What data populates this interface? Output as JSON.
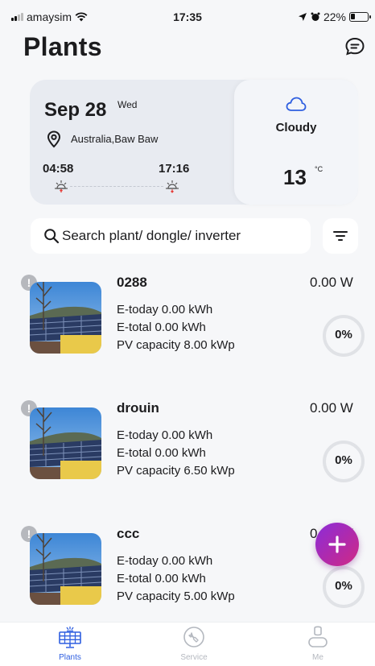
{
  "status_bar": {
    "carrier": "amaysim",
    "time": "17:35",
    "battery": "22%"
  },
  "header": {
    "title": "Plants",
    "chat_icon": "chat-bubble-icon"
  },
  "weather": {
    "date": "Sep 28",
    "weekday": "Wed",
    "location": "Australia,Baw Baw",
    "sunrise": "04:58",
    "sunset": "17:16",
    "condition": "Cloudy",
    "temperature": "13",
    "unit": "°C",
    "condition_icon": "cloud-icon"
  },
  "search": {
    "placeholder": "Search plant/ dongle/ inverter",
    "value": ""
  },
  "plants": [
    {
      "name": "0288",
      "power": "0.00 W",
      "e_today": "E-today 0.00 kWh",
      "e_total": "E-total 0.00 kWh",
      "capacity": "PV capacity 8.00 kWp",
      "percent_label": "0%",
      "percent": 0
    },
    {
      "name": "drouin",
      "power": "0.00 W",
      "e_today": "E-today 0.00 kWh",
      "e_total": "E-total 0.00 kWh",
      "capacity": "PV capacity 6.50 kWp",
      "percent_label": "0%",
      "percent": 0
    },
    {
      "name": "ccc",
      "power": "0.00 W",
      "e_today": "E-today 0.00 kWh",
      "e_total": "E-total 0.00 kWh",
      "capacity": "PV capacity 5.00 kWp",
      "percent_label": "0%",
      "percent": 0
    }
  ],
  "alert_glyph": "!",
  "bottom_nav": [
    {
      "label": "Plants",
      "active": true,
      "icon": "solar-panel-icon"
    },
    {
      "label": "Service",
      "active": false,
      "icon": "wrench-icon"
    },
    {
      "label": "Me",
      "active": false,
      "icon": "person-icon"
    }
  ],
  "colors": {
    "accent": "#2f5fe0",
    "inactive": "#b4b8bf",
    "fab_start": "#8b2bd9",
    "fab_end": "#d02a84",
    "ring": "#e0e2e6",
    "sun": "#e53935"
  }
}
